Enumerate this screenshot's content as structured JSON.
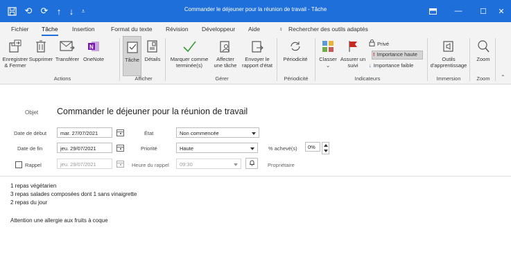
{
  "window": {
    "title": "Commander le déjeuner pour la réunion de travail  -  Tâche"
  },
  "tabs": [
    "Fichier",
    "Tâche",
    "Insertion",
    "Format du texte",
    "Révision",
    "Développeur",
    "Aide"
  ],
  "search": {
    "label": "Rechercher des outils adaptés"
  },
  "ribbon": {
    "save_close": [
      "Enregistrer",
      "& Fermer"
    ],
    "delete": "Supprimer",
    "forward": "Transférer",
    "onenote": "OneNote",
    "task": "Tâche",
    "details": "Détails",
    "mark_complete": [
      "Marquer comme",
      "terminée(s)"
    ],
    "assign": [
      "Affecter",
      "une tâche"
    ],
    "send_report": [
      "Envoyer le",
      "rapport d'état"
    ],
    "recurrence": "Périodicité",
    "categorize": "Classer",
    "follow_up": [
      "Assurer un",
      "suivi"
    ],
    "private": "Privé",
    "high_importance": "Importance haute",
    "low_importance": "Importance faible",
    "learning_tools": [
      "Outils",
      "d'apprentissage"
    ],
    "zoom": "Zoom",
    "groups": {
      "actions": "Actions",
      "show": "Afficher",
      "manage": "Gérer",
      "recurrence": "Périodicité",
      "tags": "Indicateurs",
      "immersive": "Immersion",
      "zoom": "Zoom"
    }
  },
  "form": {
    "subject_label": "Objet",
    "subject": "Commander le déjeuner pour la réunion de travail",
    "start_label": "Date de début",
    "start_date": "mar. 27/07/2021",
    "due_label": "Date de fin",
    "due_date": "jeu. 29/07/2021",
    "reminder_label": "Rappel",
    "reminder_date": "jeu. 29/07/2021",
    "status_label": "État",
    "status_value": "Non commencée",
    "priority_label": "Priorité",
    "priority_value": "Haute",
    "reminder_time_label": "Heure du rappel",
    "reminder_time": "09:30",
    "percent_label": "% achevé(s)",
    "percent_value": "0%",
    "owner_label": "Propriétaire"
  },
  "body": {
    "lines": [
      "1 repas végétarien",
      "3 repas salades composées dont 1 sans vinaigrette",
      "2 repas du jour",
      "",
      "Attention une allergie aux fruits à coque"
    ]
  },
  "colors": {
    "titlebar": "#1e6fd9",
    "ribbon_bg": "#f3f3f3",
    "onenote": "#7719aa",
    "flag_red": "#c42b1c"
  }
}
